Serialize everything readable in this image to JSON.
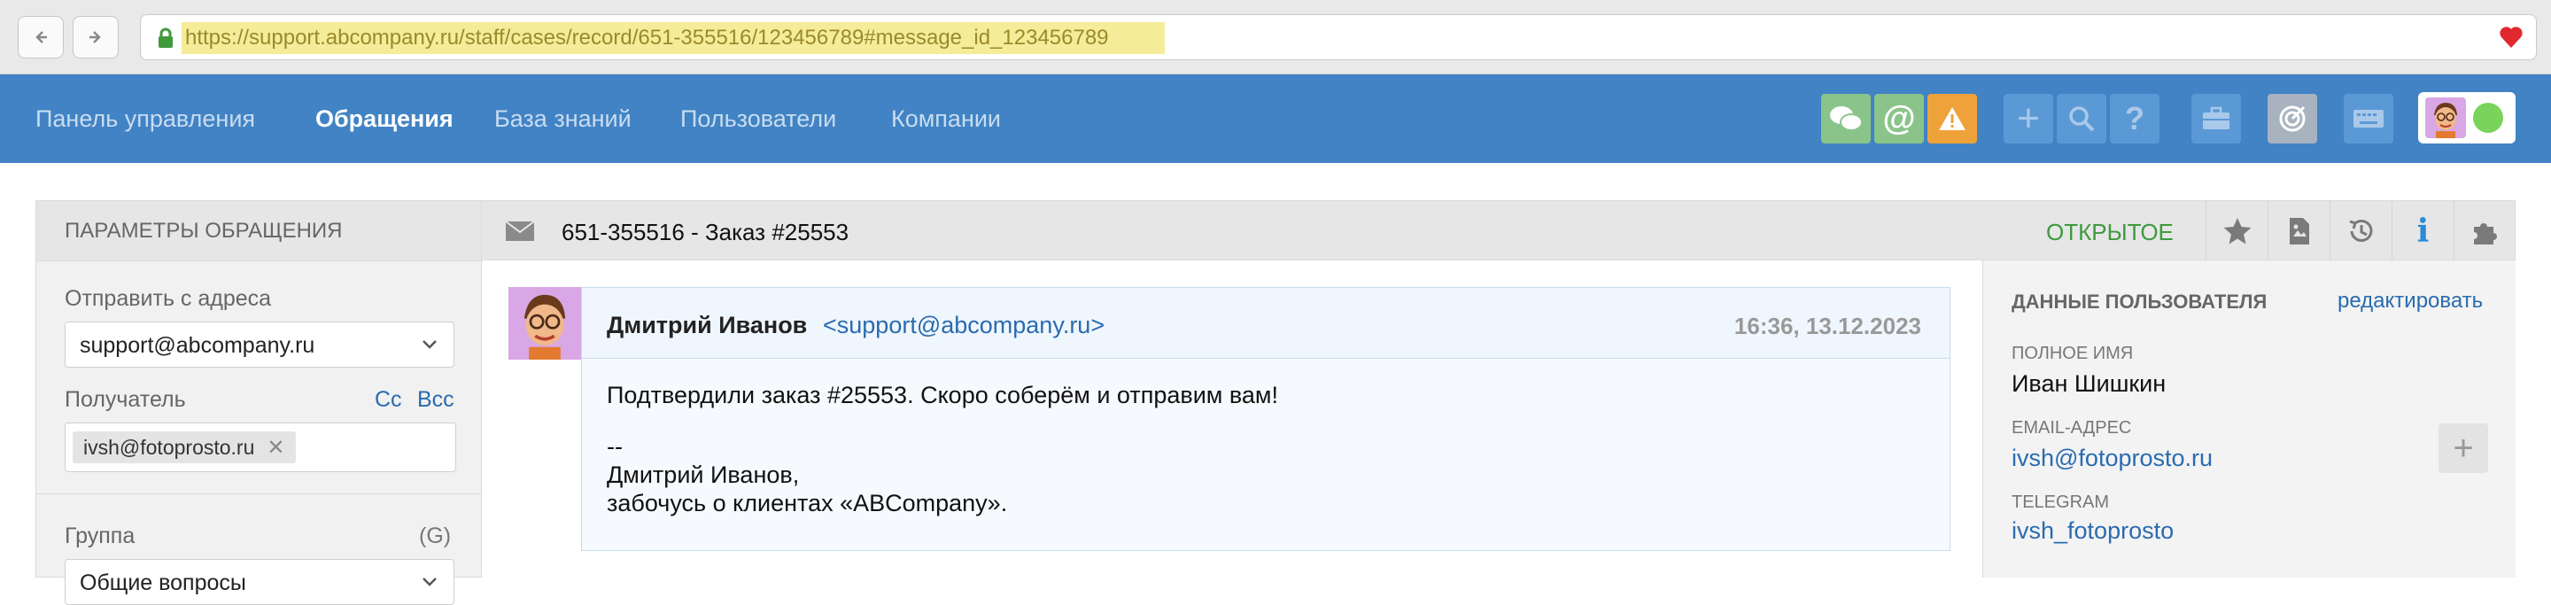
{
  "browser": {
    "url": "https://support.abcompany.ru/staff/cases/record/651-355516/123456789#message_id_123456789",
    "icons": [
      "back-arrow-icon",
      "forward-arrow-icon",
      "lock-icon",
      "heart-icon"
    ]
  },
  "nav": {
    "items": [
      {
        "label": "Панель управления",
        "active": false
      },
      {
        "label": "Обращения",
        "active": true
      },
      {
        "label": "База знаний",
        "active": false
      },
      {
        "label": "Пользователи",
        "active": false
      },
      {
        "label": "Компании",
        "active": false
      }
    ],
    "tools": [
      {
        "icon": "chat-icon",
        "color": "#8bc48a"
      },
      {
        "icon": "at-icon",
        "color": "#8bc48a"
      },
      {
        "icon": "warning-icon",
        "color": "#f0a23a"
      },
      {
        "icon": "plus-icon",
        "color": "#5b99d6"
      },
      {
        "icon": "search-icon",
        "color": "#5b99d6"
      },
      {
        "icon": "help-icon",
        "color": "#5b99d6"
      },
      {
        "icon": "briefcase-icon",
        "color": "#5b99d6"
      },
      {
        "icon": "target-icon",
        "color": "#a8b3bf"
      },
      {
        "icon": "keyboard-icon",
        "color": "#5b99d6"
      }
    ],
    "status_color": "#7ad35a"
  },
  "left": {
    "title": "ПАРАМЕТРЫ ОБРАЩЕНИЯ",
    "from_label": "Отправить с адреса",
    "from_value": "support@abcompany.ru",
    "recipient_label": "Получатель",
    "cc": "Cc",
    "bcc": "Bcc",
    "recipient_tag": "ivsh@fotoprosto.ru",
    "group_label": "Группа",
    "group_hotkey": "(G)",
    "group_value": "Общие вопросы"
  },
  "ticket": {
    "title": "651-355516 - Заказ #25553",
    "status": "ОТКРЫТОЕ",
    "status_color": "#3d9a3d",
    "tools": [
      "star-icon",
      "document-icon",
      "history-icon",
      "info-icon",
      "puzzle-icon"
    ]
  },
  "message": {
    "author": "Дмитрий Иванов",
    "email": "<support@abcompany.ru>",
    "time": "16:36, 13.12.2023",
    "line1": "Подтвердили заказ #25553. Скоро соберём и отправим вам!",
    "sep": "--",
    "sig1": "Дмитрий Иванов,",
    "sig2": "забочусь о клиентах «ABCompany»."
  },
  "user": {
    "title": "ДАННЫЕ ПОЛЬЗОВАТЕЛЯ",
    "edit": "редактировать",
    "name_label": "ПОЛНОЕ ИМЯ",
    "name": "Иван Шишкин",
    "email_label": "EMAIL-АДРЕС",
    "email": "ivsh@fotoprosto.ru",
    "telegram_label": "TELEGRAM",
    "telegram": "ivsh_fotoprosto"
  }
}
